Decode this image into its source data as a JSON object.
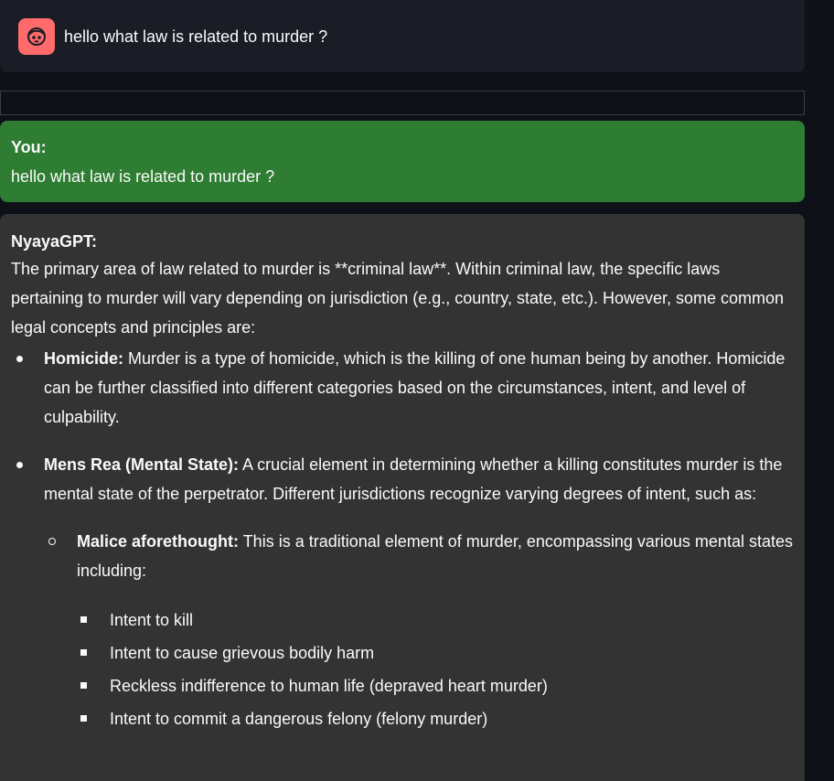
{
  "header": {
    "avatar_icon": "user-face-icon",
    "avatar_color": "#ff6b6b",
    "query": "hello what law is related to murder ?"
  },
  "user_message": {
    "speaker": "You:",
    "text": "hello what law is related to murder ?",
    "bubble_color": "#2e7d32"
  },
  "bot_message": {
    "speaker": "NyayaGPT:",
    "intro": "The primary area of law related to murder is **criminal law**. Within criminal law, the specific laws pertaining to murder will vary depending on jurisdiction (e.g., country, state, etc.). However, some common legal concepts and principles are:",
    "items": [
      {
        "term": "Homicide:",
        "text": " Murder is a type of homicide, which is the killing of one human being by another. Homicide can be further classified into different categories based on the circumstances, intent, and level of culpability."
      },
      {
        "term": "Mens Rea (Mental State):",
        "text": " A crucial element in determining whether a killing constitutes murder is the mental state of the perpetrator. Different jurisdictions recognize varying degrees of intent, such as:",
        "sub": [
          {
            "term": "Malice aforethought:",
            "text": " This is a traditional element of murder, encompassing various mental states including:",
            "sub": [
              "Intent to kill",
              "Intent to cause grievous bodily harm",
              "Reckless indifference to human life (depraved heart murder)",
              "Intent to commit a dangerous felony (felony murder)"
            ]
          }
        ]
      }
    ],
    "bubble_color": "#333333"
  }
}
